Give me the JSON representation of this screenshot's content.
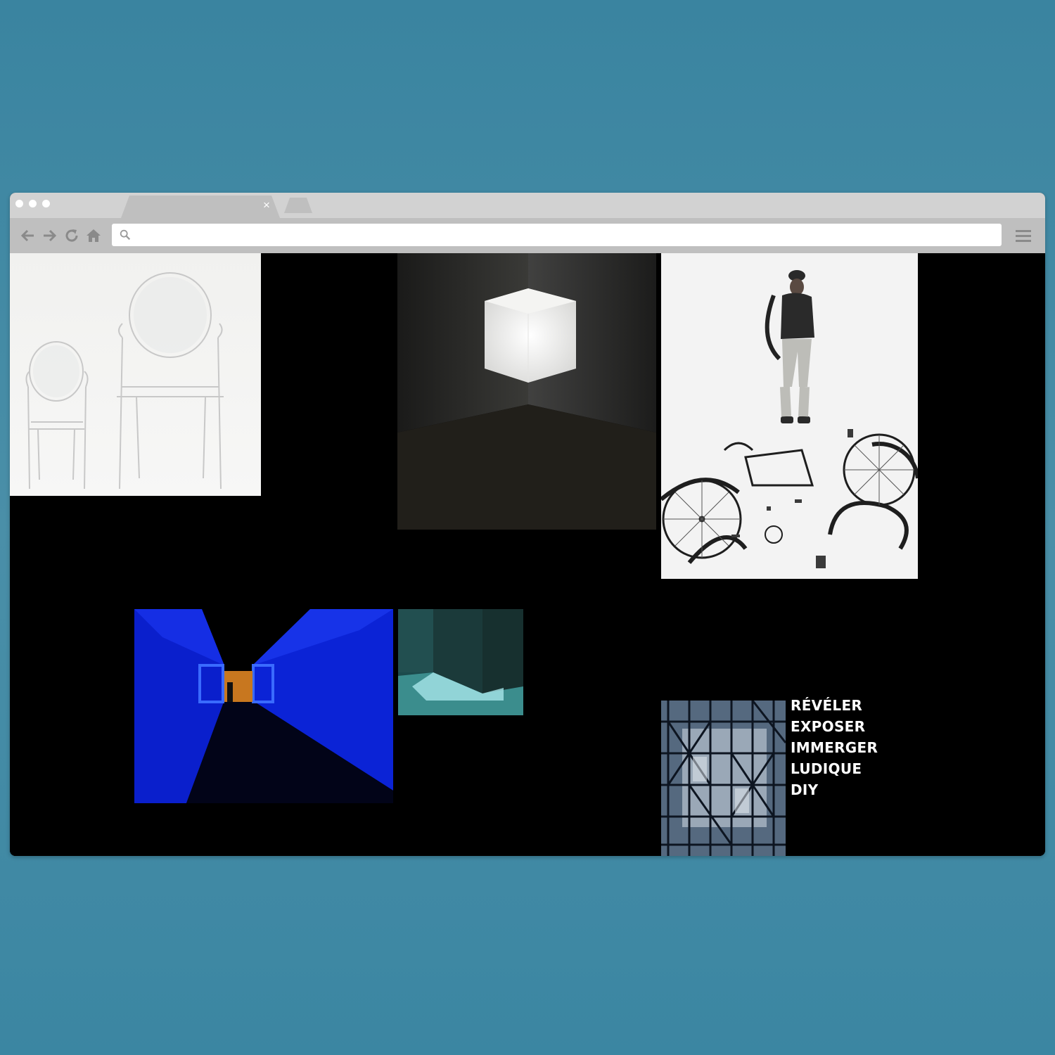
{
  "browser": {
    "tab_close_glyph": "×",
    "address_bar": {
      "value": "",
      "placeholder": ""
    },
    "icons": [
      "back-arrow-icon",
      "forward-arrow-icon",
      "reload-icon",
      "home-icon",
      "search-icon",
      "hamburger-menu-icon"
    ]
  },
  "moodboard": {
    "images": [
      {
        "name": "ghost-chairs-image",
        "subject": "two transparent chairs"
      },
      {
        "name": "light-cube-image",
        "subject": "glowing projected cube in corner"
      },
      {
        "name": "bicycle-parts-image",
        "subject": "man with disassembled bicycle"
      },
      {
        "name": "blue-light-corridor-image",
        "subject": "blue light tunnel"
      },
      {
        "name": "teal-light-volume-image",
        "subject": "teal glowing volume"
      },
      {
        "name": "steel-structure-image",
        "subject": "building steel framework"
      }
    ],
    "keywords": [
      "RÉVÉLER",
      "EXPOSER",
      "IMMERGER",
      "LUDIQUE",
      "DIY"
    ]
  },
  "colors": {
    "background": "#3f89a4",
    "chrome": "#d2d2d2",
    "toolbar": "#bfbfbf",
    "page": "#000000",
    "keyword_text": "#ffffff"
  }
}
